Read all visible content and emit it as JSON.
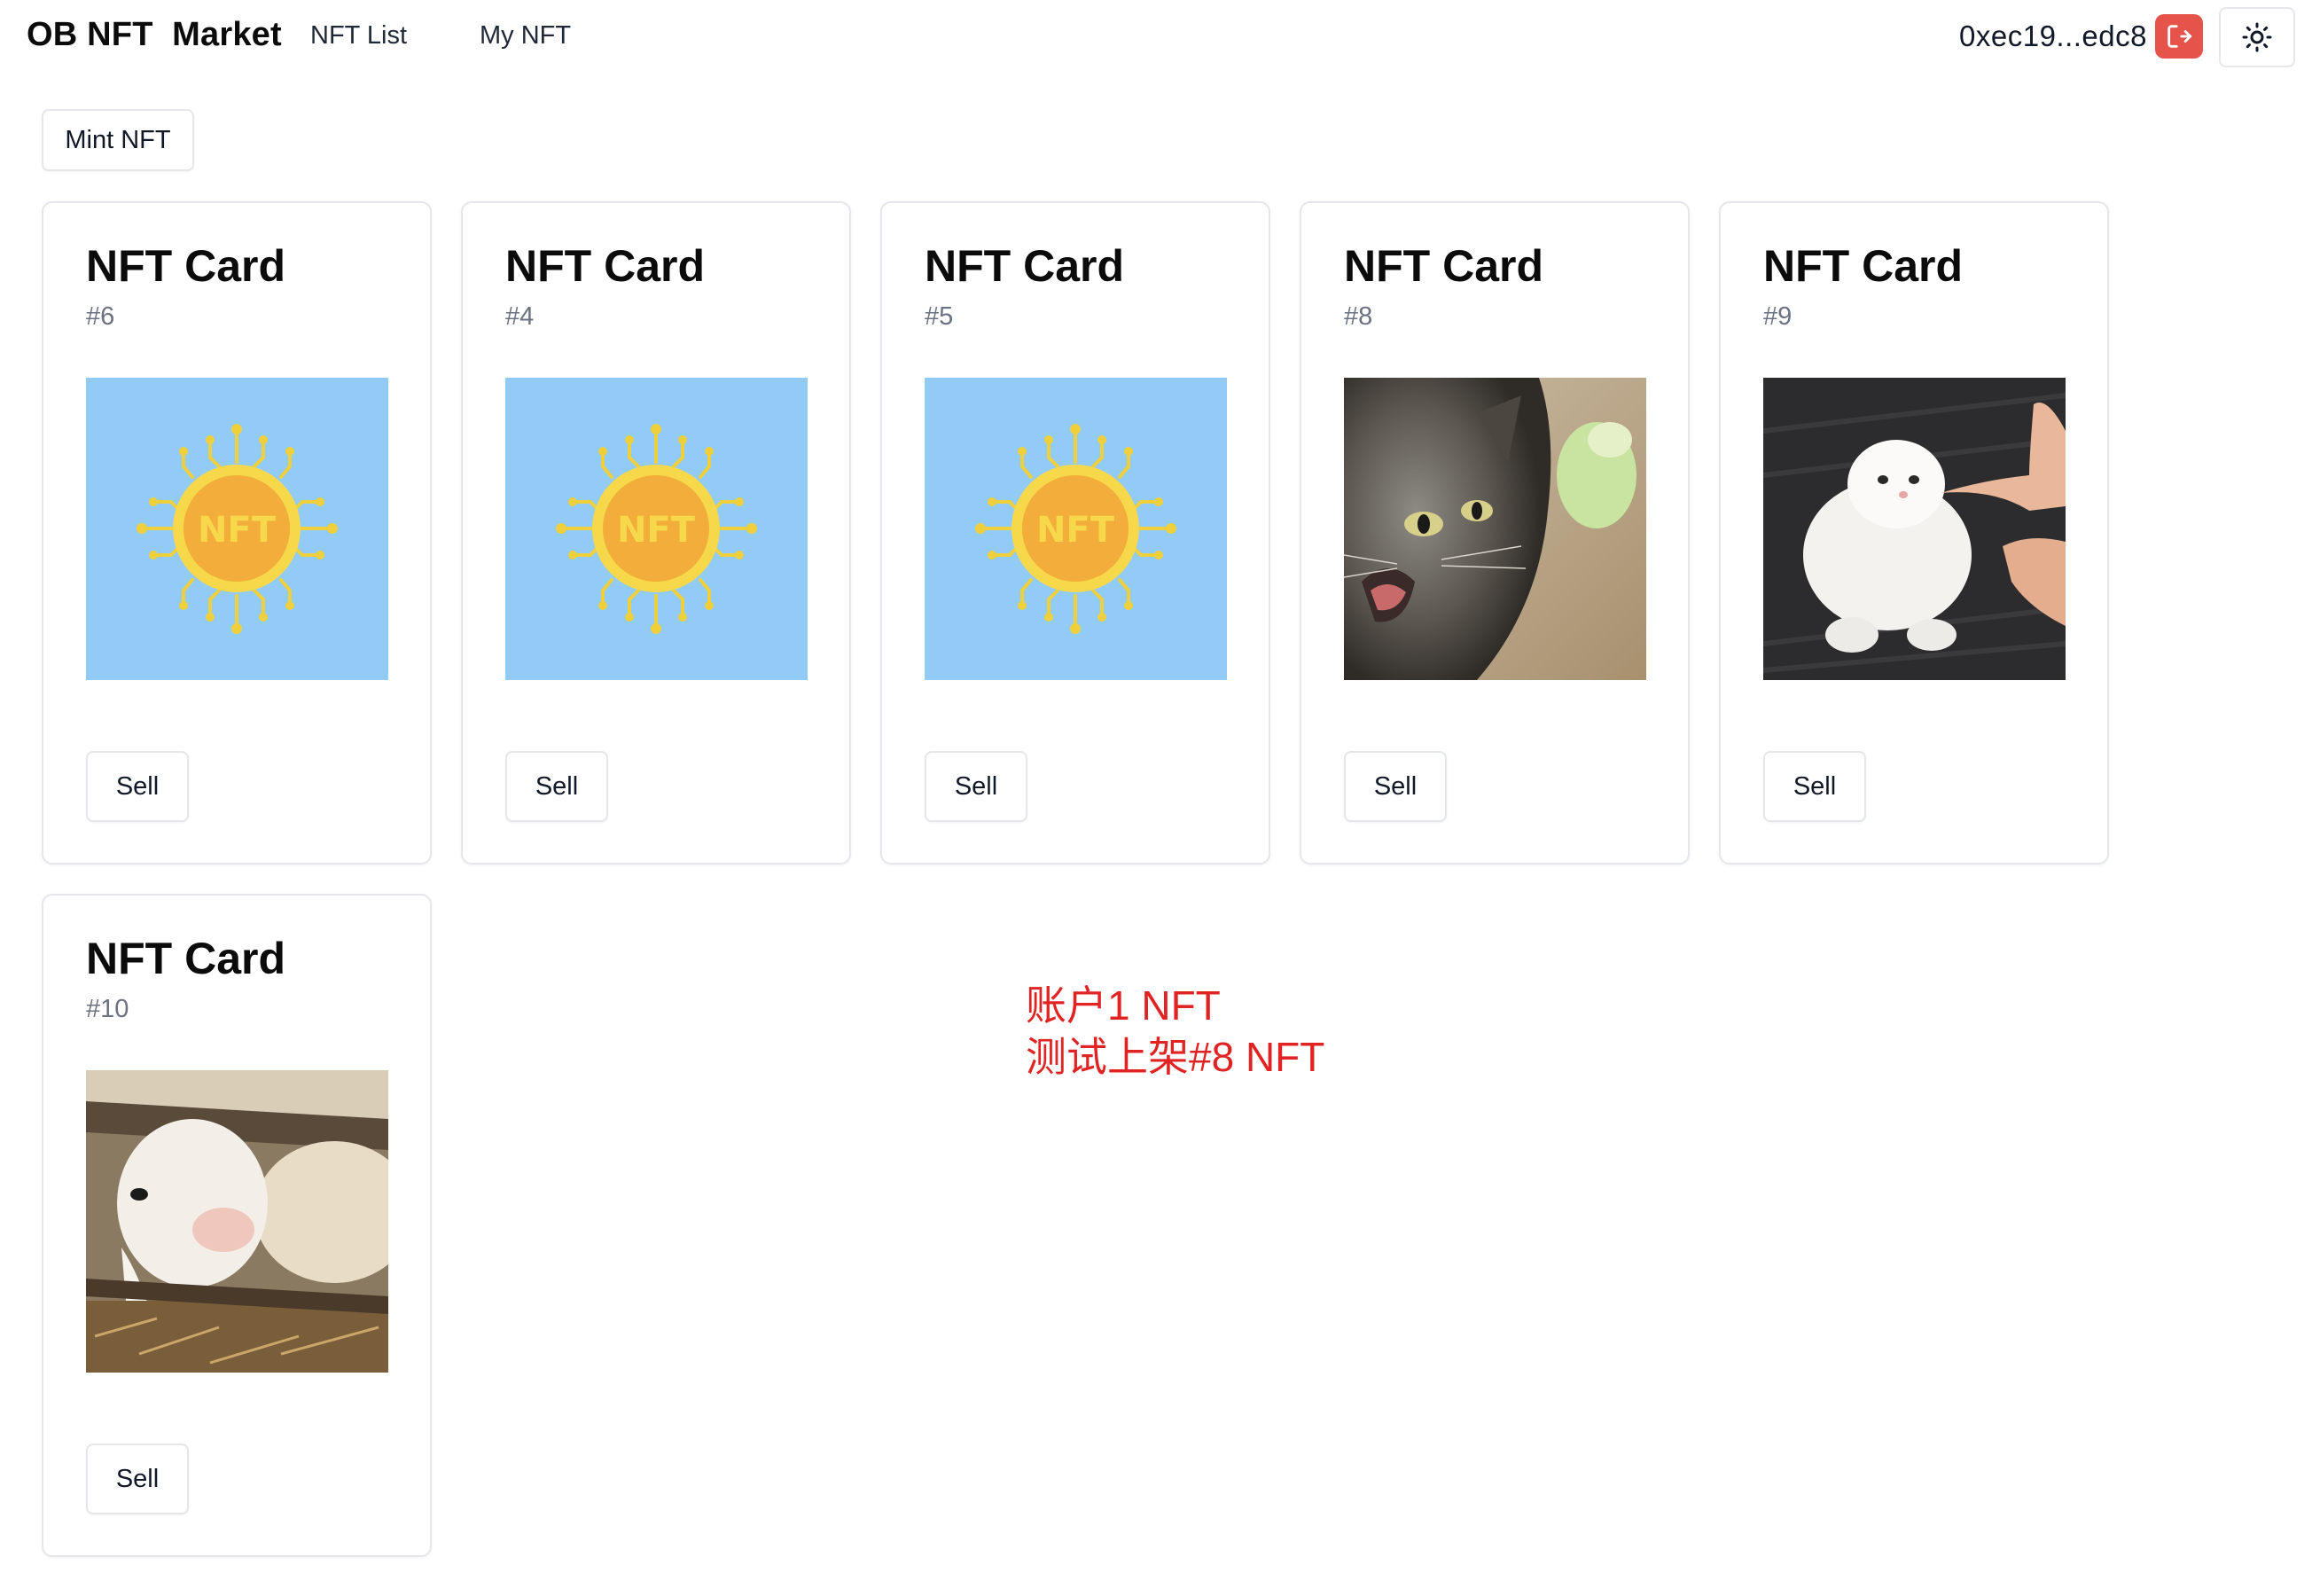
{
  "header": {
    "brand": "OB NFT  Market",
    "nav": [
      {
        "label": "NFT List"
      },
      {
        "label": "My NFT"
      }
    ],
    "account": "0xec19...edc8",
    "logout_icon": "logout-icon",
    "theme_icon": "sun-icon",
    "accent_color": "#e5534b"
  },
  "actions": {
    "mint_label": "Mint NFT"
  },
  "cards": [
    {
      "title": "NFT Card",
      "id": "#6",
      "image": "nft-chip-logo",
      "sell_label": "Sell"
    },
    {
      "title": "NFT Card",
      "id": "#4",
      "image": "nft-chip-logo",
      "sell_label": "Sell"
    },
    {
      "title": "NFT Card",
      "id": "#5",
      "image": "nft-chip-logo",
      "sell_label": "Sell"
    },
    {
      "title": "NFT Card",
      "id": "#8",
      "image": "angry-grey-cat-photo",
      "sell_label": "Sell"
    },
    {
      "title": "NFT Card",
      "id": "#9",
      "image": "white-kitten-photo",
      "sell_label": "Sell"
    },
    {
      "title": "NFT Card",
      "id": "#10",
      "image": "lamb-photo",
      "sell_label": "Sell"
    }
  ],
  "logo_text": "NFT",
  "annotation": {
    "line1": "账户1 NFT",
    "line2": "测试上架#8 NFT",
    "color": "#e02424"
  }
}
